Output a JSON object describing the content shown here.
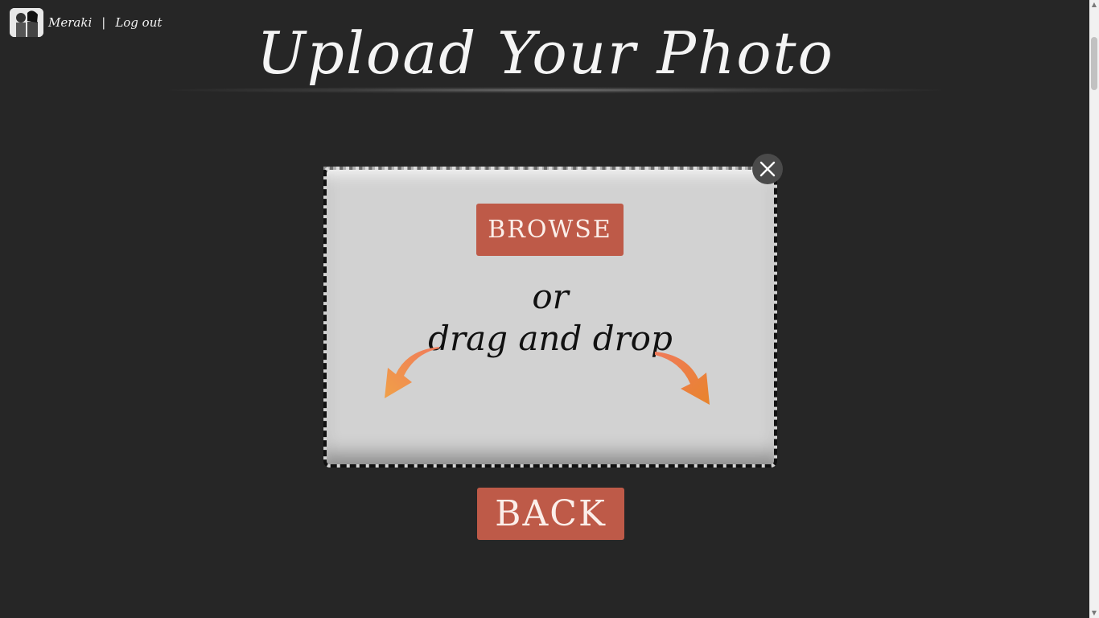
{
  "header": {
    "username": "Meraki",
    "separator": "|",
    "logout_label": "Log out",
    "avatar_icon": "couple-photo-avatar"
  },
  "page": {
    "title": "Upload Your Photo"
  },
  "dropzone": {
    "browse_label": "BROWSE",
    "or_text": "or",
    "drag_text": "drag and drop",
    "close_icon": "close-icon",
    "arrow_color": "#ee8a3c"
  },
  "footer": {
    "back_label": "BACK"
  },
  "colors": {
    "background": "#262626",
    "button": "#be5a48",
    "dropzone": "#d2d2d2"
  }
}
